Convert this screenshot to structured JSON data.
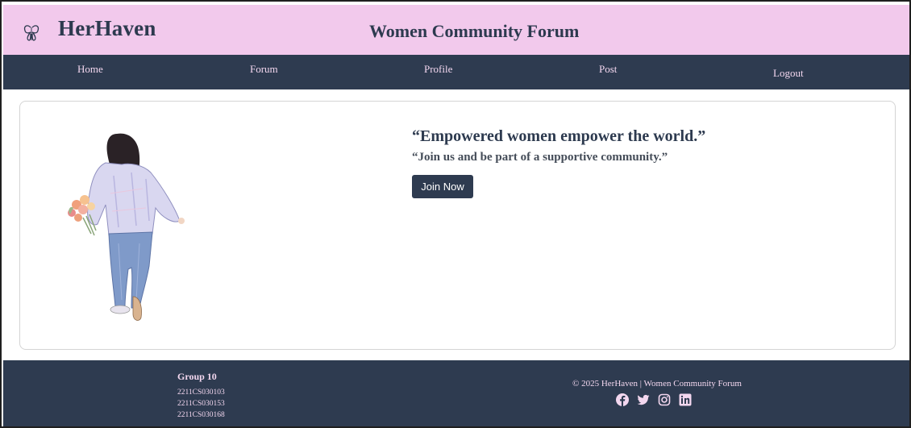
{
  "header": {
    "brand": "HerHaven",
    "title": "Women Community Forum",
    "logo_icon": "butterfly-icon",
    "background": "#f2c9ec"
  },
  "nav": {
    "items": [
      {
        "label": "Home"
      },
      {
        "label": "Forum"
      },
      {
        "label": "Profile"
      },
      {
        "label": "Post"
      },
      {
        "label": "Logout"
      }
    ],
    "background": "#2e3b50",
    "text_color": "#f3d7ef"
  },
  "hero": {
    "quote": "“Empowered women empower the world.”",
    "subquote": "“Join us and be part of a supportive community.”",
    "button_label": "Join Now",
    "illustration": "woman-with-flowers-illustration"
  },
  "footer": {
    "group_title": "Group 10",
    "ids": [
      "2211CS030103",
      "2211CS030153",
      "2211CS030168"
    ],
    "copyright": "© 2025 HerHaven | Women Community Forum",
    "socials": [
      "facebook-icon",
      "twitter-icon",
      "instagram-icon",
      "linkedin-icon"
    ]
  }
}
